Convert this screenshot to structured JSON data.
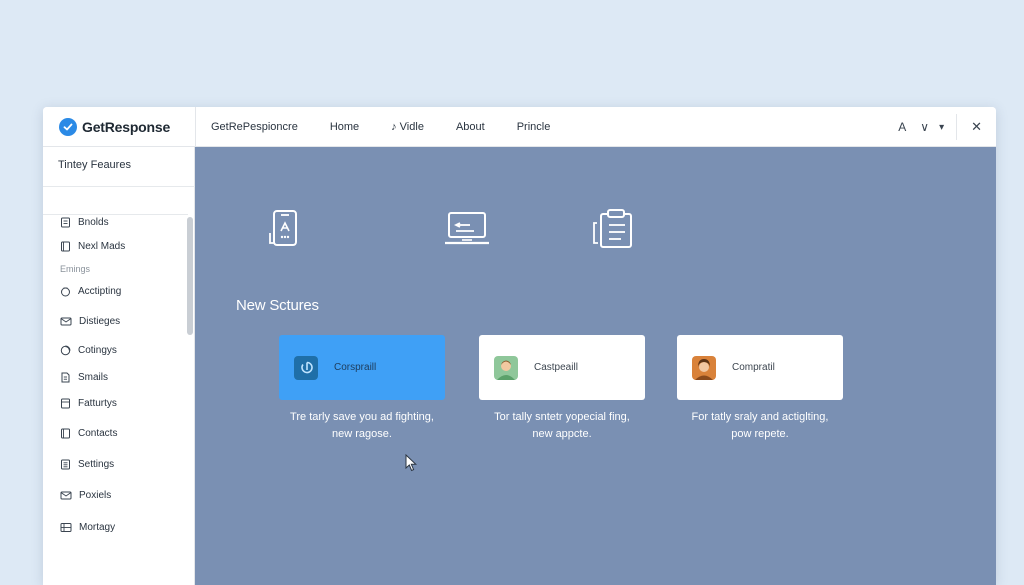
{
  "app": {
    "logo_text": "GetResponse",
    "brand_color": "#2b8ae6"
  },
  "topbar": {
    "nav": [
      "GetRePespioncre",
      "Home",
      "Vidle",
      "About",
      "Princle"
    ],
    "controls": {
      "font_label": "A",
      "chevron_label": "∨",
      "dropdown_label": "▾",
      "close_label": "✕"
    }
  },
  "sidebar": {
    "title": "Tintey Feaures",
    "items": [
      {
        "label": "Bnolds",
        "icon": "document-icon"
      },
      {
        "label": "Nexl Mads",
        "icon": "book-icon"
      }
    ],
    "section_label": "Emings",
    "items2": [
      {
        "label": "Acctipting",
        "icon": "circle-icon"
      },
      {
        "label": "Distieges",
        "icon": "mail-icon"
      },
      {
        "label": "Cotingys",
        "icon": "ring-icon"
      },
      {
        "label": "Smails",
        "icon": "document-icon"
      },
      {
        "label": "Fatturtys",
        "icon": "layers-icon"
      },
      {
        "label": "Contacts",
        "icon": "book-icon"
      },
      {
        "label": "Settings",
        "icon": "list-icon"
      },
      {
        "label": "Poxiels",
        "icon": "mail-icon"
      },
      {
        "label": "Mortagy",
        "icon": "grid-icon"
      }
    ]
  },
  "main": {
    "section_title": "New Sctures",
    "background": "#7a90b3",
    "accent": "#3fa0f6",
    "cards": [
      {
        "label": "Corspraill",
        "desc_line1": "Tre tarly save you ad fighting,",
        "desc_line2": "new ragose.",
        "active": true
      },
      {
        "label": "Castpeaill",
        "desc_line1": "Tor tally sntetr yopecial fing,",
        "desc_line2": "new appcte.",
        "active": false
      },
      {
        "label": "Compratil",
        "desc_line1": "For tatly sraly and actiglting,",
        "desc_line2": "pow repete.",
        "active": false
      }
    ]
  }
}
